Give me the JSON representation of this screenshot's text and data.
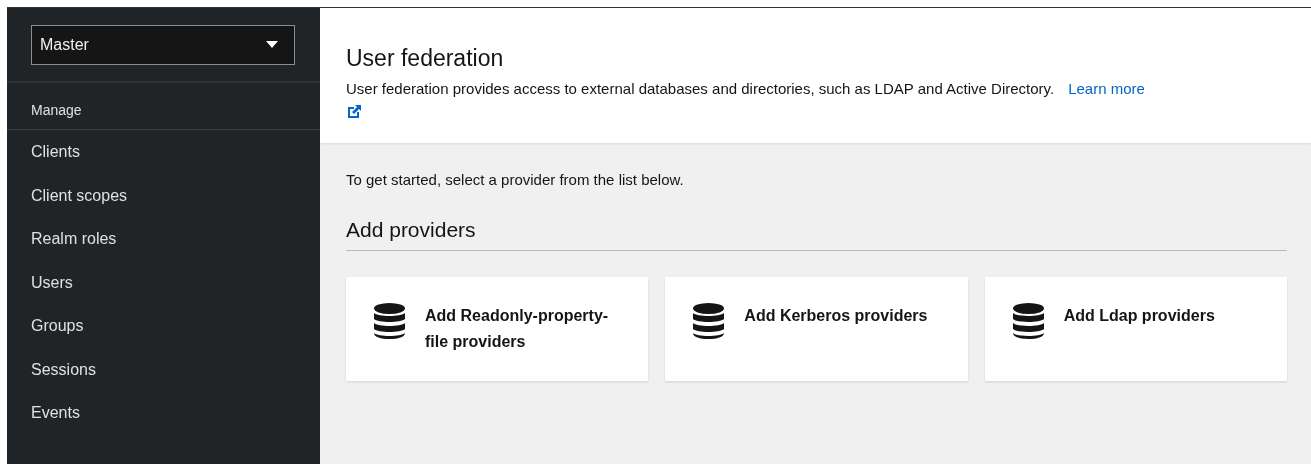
{
  "sidebar": {
    "realm_selector": {
      "value": "Master"
    },
    "section": "Manage",
    "items": [
      {
        "label": "Clients"
      },
      {
        "label": "Client scopes"
      },
      {
        "label": "Realm roles"
      },
      {
        "label": "Users"
      },
      {
        "label": "Groups"
      },
      {
        "label": "Sessions"
      },
      {
        "label": "Events"
      }
    ]
  },
  "header": {
    "title": "User federation",
    "description": "User federation provides access to external databases and directories, such as LDAP and Active Directory.",
    "link": "Learn more"
  },
  "intro": "To get started, select a provider from the list below.",
  "section_title": "Add providers",
  "providers": [
    {
      "label": "Add Readonly-property-file providers"
    },
    {
      "label": "Add Kerberos providers"
    },
    {
      "label": "Add Ldap providers"
    }
  ]
}
